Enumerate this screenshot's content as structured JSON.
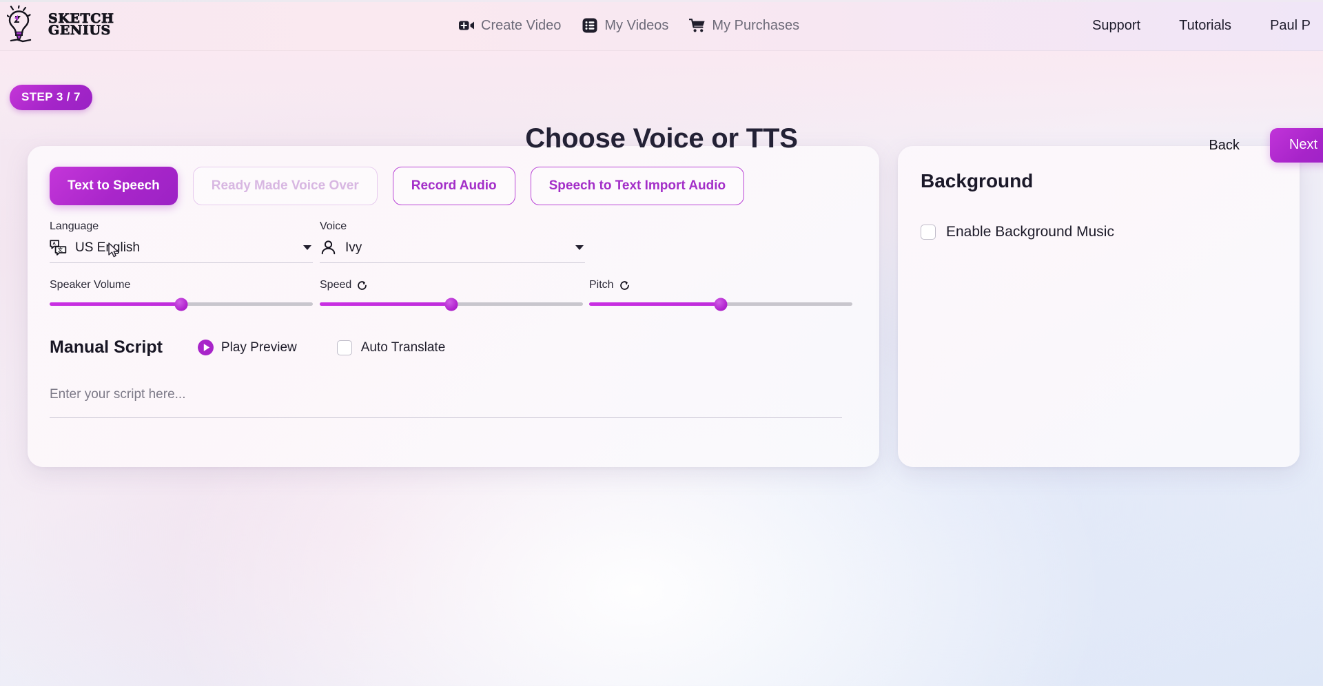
{
  "brand": {
    "line1": "SKETCH",
    "line2": "GENIUS",
    "logo_icon": "lightbulb-sketch-icon"
  },
  "topnav": {
    "center_items": [
      {
        "label": "Create Video",
        "icon": "video-camera-plus-icon"
      },
      {
        "label": "My Videos",
        "icon": "list-icon"
      },
      {
        "label": "My Purchases",
        "icon": "shopping-cart-icon"
      }
    ],
    "right_items": [
      {
        "label": "Support"
      },
      {
        "label": "Tutorials"
      },
      {
        "label": "Paul P"
      }
    ]
  },
  "header": {
    "step_badge": "STEP 3 / 7",
    "title": "Choose Voice or TTS",
    "back_label": "Back",
    "next_label": "Next"
  },
  "main": {
    "tabs": [
      {
        "label": "Text to Speech",
        "state": "active"
      },
      {
        "label": "Ready Made Voice Over",
        "state": "disabled"
      },
      {
        "label": "Record Audio",
        "state": "outline"
      },
      {
        "label": "Speech to Text Import Audio",
        "state": "outline"
      }
    ],
    "language": {
      "label": "Language",
      "value": "US English",
      "icon": "translate-icon"
    },
    "voice": {
      "label": "Voice",
      "value": "Ivy",
      "icon": "person-icon"
    },
    "sliders": [
      {
        "label": "Speaker Volume",
        "value": 50,
        "has_reset": false
      },
      {
        "label": "Speed",
        "value": 50,
        "has_reset": true,
        "reset_icon": "reset-arrow-icon"
      },
      {
        "label": "Pitch",
        "value": 50,
        "has_reset": true,
        "reset_icon": "reset-arrow-icon"
      }
    ],
    "script": {
      "title": "Manual Script",
      "play_preview_label": "Play Preview",
      "play_icon": "play-circle-icon",
      "auto_translate_label": "Auto Translate",
      "auto_translate_checked": false,
      "placeholder": "Enter your script here...",
      "value": ""
    }
  },
  "background_panel": {
    "title": "Background",
    "enable_music_label": "Enable Background Music",
    "enable_music_checked": false
  },
  "colors": {
    "accent": "#b225cf",
    "accent_light": "#c436d9",
    "text_dark": "#1b1929",
    "muted": "#6c6a78",
    "disabled_text": "#d8b7e2"
  }
}
